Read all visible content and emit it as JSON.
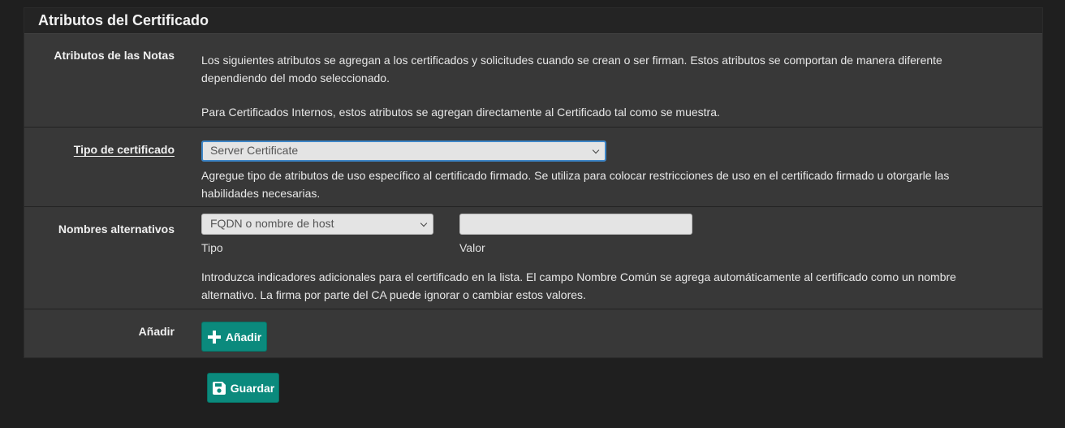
{
  "panel": {
    "title": "Atributos del Certificado"
  },
  "notes": {
    "label": "Atributos de las Notas",
    "line1": "Los siguientes atributos se agregan a los certificados y solicitudes cuando se crean o ser firman. Estos atributos se comportan de manera diferente",
    "line2": "dependiendo del modo seleccionado.",
    "line3": "Para Certificados Internos, estos atributos se agregan directamente al Certificado tal como se muestra."
  },
  "cert_type": {
    "label": "Tipo de certificado",
    "selected": "Server Certificate",
    "help_line1": "Agregue tipo de atributos de uso específico al certificado firmado. Se utiliza para colocar restricciones de uso en el certificado firmado u otorgarle las",
    "help_line2": "habilidades necesarias."
  },
  "alt_names": {
    "label": "Nombres alternativos",
    "type_selected": "FQDN o nombre de host",
    "type_label": "Tipo",
    "value": "",
    "value_label": "Valor",
    "help_line1": "Introduzca indicadores adicionales para el certificado en la lista. El campo Nombre Común se agrega automáticamente al certificado como un nombre",
    "help_line2": "alternativo. La firma por parte del CA puede ignorar o cambiar estos valores."
  },
  "add": {
    "label": "Añadir",
    "button": "Añadir"
  },
  "save": {
    "button": "Guardar"
  },
  "colors": {
    "accent": "#0b8a7d",
    "panel": "#383838",
    "background": "#1f1f1f",
    "focus": "#3e86c7"
  }
}
